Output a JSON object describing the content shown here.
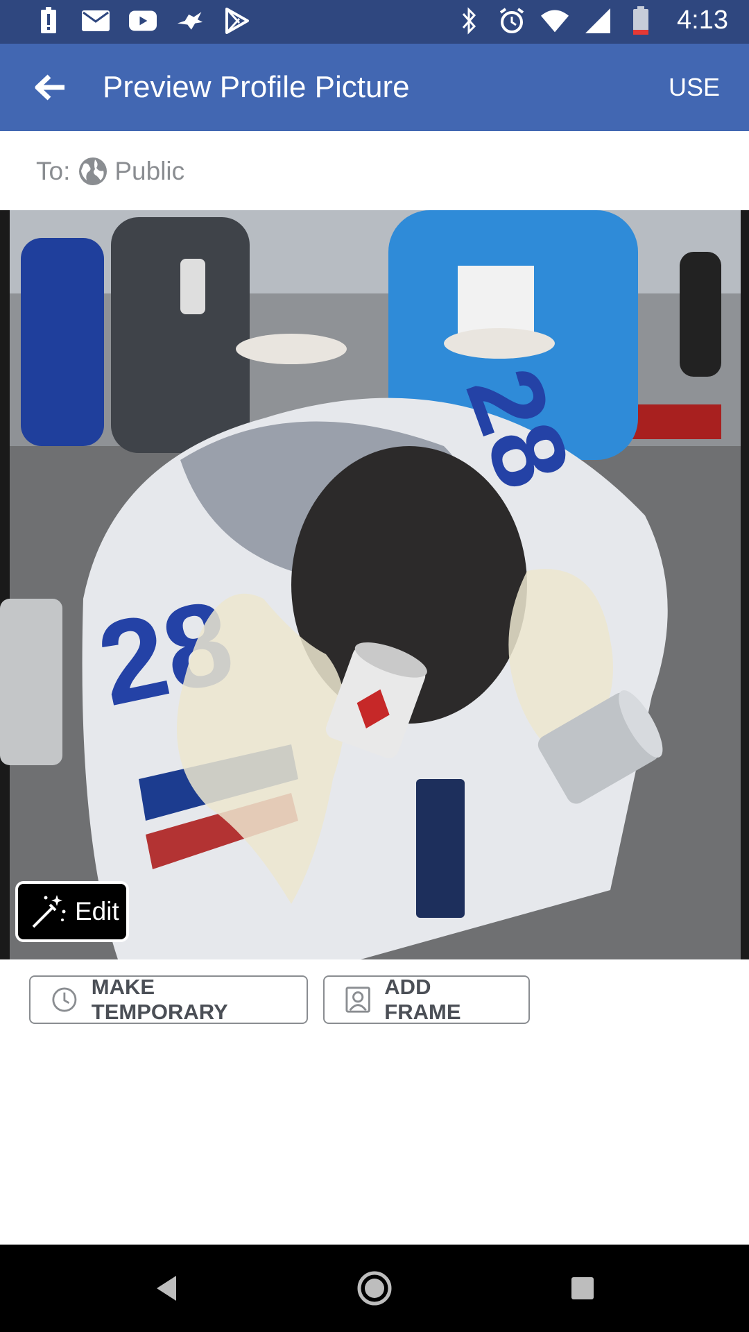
{
  "status_bar": {
    "time": "4:13",
    "left_icons": [
      "battery-alert-icon",
      "mail-icon",
      "youtube-icon",
      "bird-app-icon",
      "play-store-icon"
    ],
    "right_icons": [
      "bluetooth-icon",
      "alarm-icon",
      "wifi-icon",
      "cell-signal-icon",
      "battery-low-icon"
    ]
  },
  "app_bar": {
    "title": "Preview Profile Picture",
    "use_label": "USE"
  },
  "audience": {
    "prefix": "To:",
    "value": "Public"
  },
  "photo": {
    "edit_label": "Edit"
  },
  "actions": {
    "make_temporary": "MAKE TEMPORARY",
    "add_frame": "ADD FRAME"
  },
  "colors": {
    "status_bar": "#2f477f",
    "app_bar": "#4267b2",
    "muted_text": "#8a8d91",
    "button_text": "#4b4f56"
  }
}
